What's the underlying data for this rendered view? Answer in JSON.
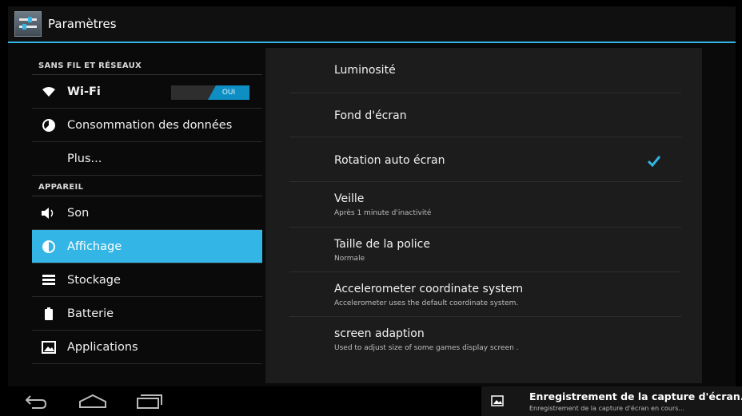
{
  "window": {
    "title": "Paramètres"
  },
  "sidebar": {
    "sections": [
      "SANS FIL ET RÉSEAUX",
      "APPAREIL"
    ],
    "items": [
      {
        "label": "Wi-Fi",
        "icon": "wifi-icon"
      },
      {
        "label": "Consommation des données",
        "icon": "data-usage-icon"
      },
      {
        "label": "Plus..."
      },
      {
        "label": "Son",
        "icon": "speaker-icon"
      },
      {
        "label": "Affichage",
        "icon": "display-icon",
        "selected": true
      },
      {
        "label": "Stockage",
        "icon": "storage-icon"
      },
      {
        "label": "Batterie",
        "icon": "battery-icon"
      },
      {
        "label": "Applications",
        "icon": "applications-icon"
      }
    ],
    "wifi_toggle": "OUI"
  },
  "display": {
    "items": [
      {
        "title": "Luminosité"
      },
      {
        "title": "Fond d'écran"
      },
      {
        "title": "Rotation auto écran",
        "checked": true
      },
      {
        "title": "Veille",
        "summary": "Après 1 minute d'inactivité"
      },
      {
        "title": "Taille de la police",
        "summary": "Normale"
      },
      {
        "title": "Accelerometer coordinate system",
        "summary": "Accelerometer uses the default coordinate system."
      },
      {
        "title": "screen adaption",
        "summary": "Used to adjust size of some games display screen ."
      }
    ]
  },
  "notification": {
    "title": "Enregistrement de la capture d'écran..",
    "text": "Enregistrement de la capture d'écran en cours..."
  },
  "colors": {
    "accent": "#33b5e5",
    "background": "#000000",
    "panel": "#1c1c1c"
  }
}
